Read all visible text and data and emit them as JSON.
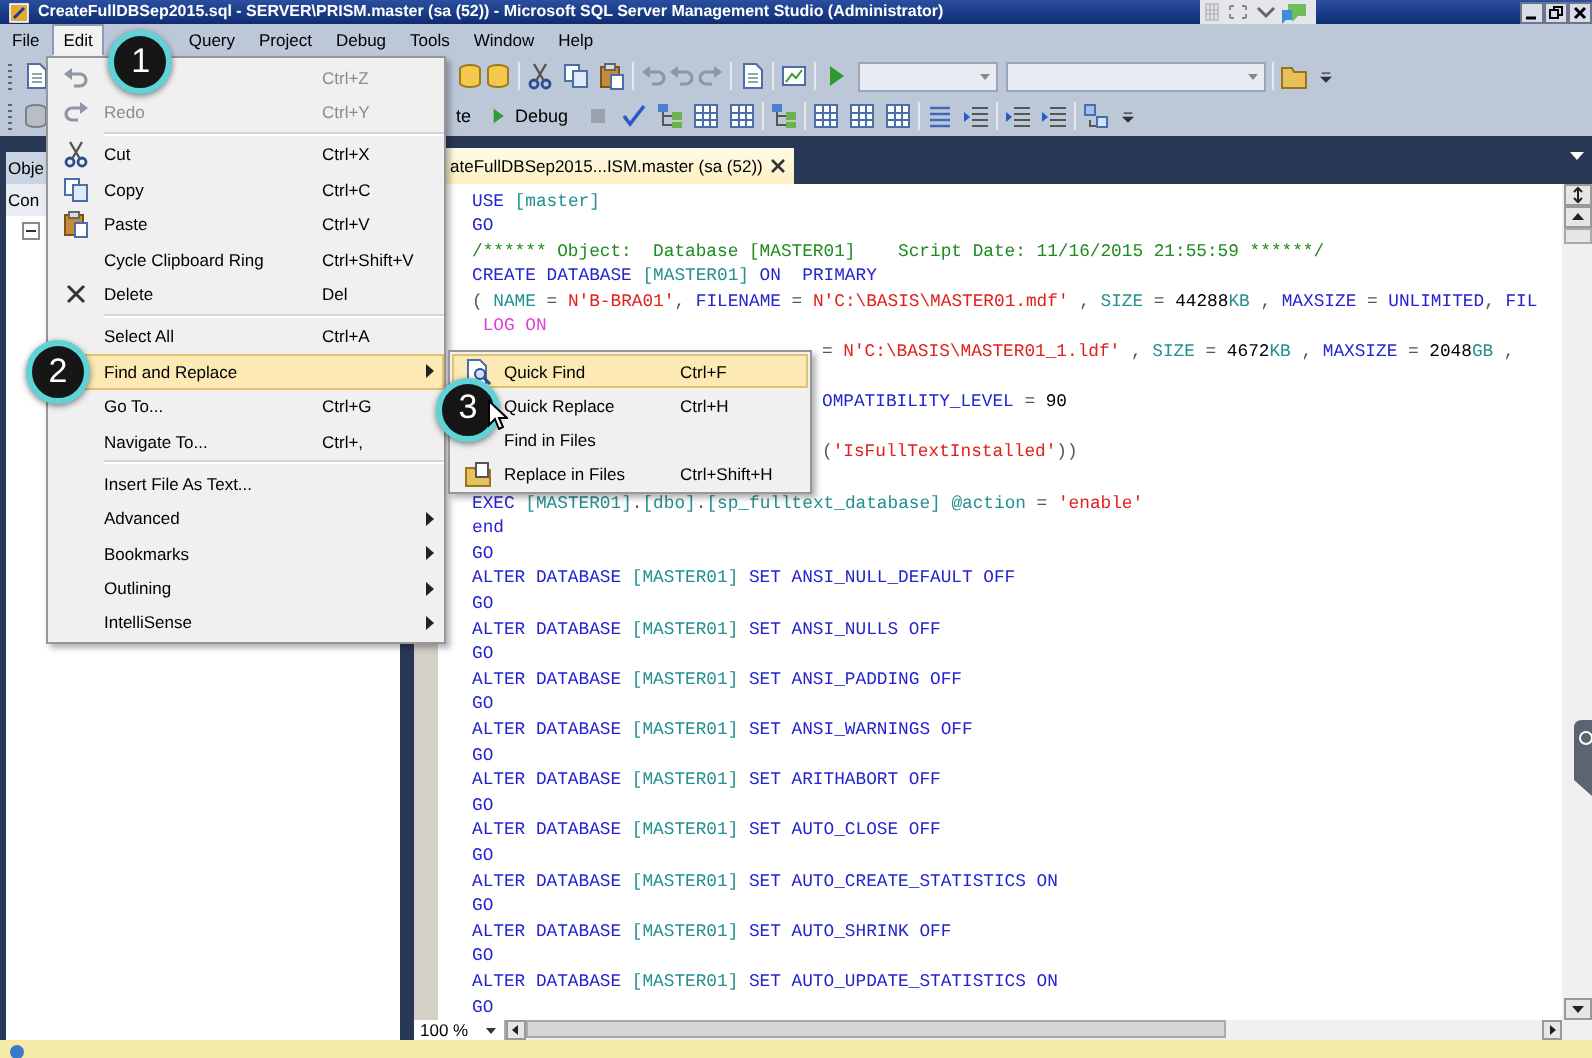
{
  "window": {
    "title": "CreateFullDBSep2015.sql - SERVER\\PRISM.master (sa (52)) - Microsoft SQL Server Management Studio (Administrator)"
  },
  "menu_bar": [
    {
      "label": "File",
      "selected": false
    },
    {
      "label": "Edit",
      "selected": true,
      "callout": "1"
    },
    {
      "label": "Query",
      "selected": false
    },
    {
      "label": "Project",
      "selected": false
    },
    {
      "label": "Debug",
      "selected": false
    },
    {
      "label": "Tools",
      "selected": false
    },
    {
      "label": "Window",
      "selected": false
    },
    {
      "label": "Help",
      "selected": false
    }
  ],
  "toolbar": {
    "execute_label": "te",
    "debug_label": "Debug"
  },
  "object_explorer": {
    "title": "Obje",
    "connect_label": "Con",
    "expanded": true
  },
  "document_tab": {
    "title": "ateFullDBSep2015...ISM.master (sa (52))"
  },
  "editor": {
    "zoom": "100 %",
    "lines": [
      {
        "covered": false,
        "tokens": [
          {
            "kind": "keyword",
            "text": "USE"
          },
          {
            "kind": "identifier",
            "text": " [master]"
          }
        ]
      },
      {
        "covered": false,
        "tokens": [
          {
            "kind": "keyword",
            "text": "GO"
          }
        ]
      },
      {
        "covered": false,
        "tokens": [
          {
            "kind": "comment",
            "text": "/****** Object:  Database [MASTER01]    Script Date: 11/16/2015 21:55:59 ******/"
          }
        ]
      },
      {
        "covered": false,
        "tokens": [
          {
            "kind": "keyword",
            "text": "CREATE DATABASE"
          },
          {
            "kind": "identifier",
            "text": " [MASTER01]"
          },
          {
            "kind": "keyword",
            "text": " ON  PRIMARY"
          }
        ]
      },
      {
        "covered": false,
        "tokens": [
          {
            "kind": "plain",
            "text": "( "
          },
          {
            "kind": "identifier",
            "text": "NAME"
          },
          {
            "kind": "plain",
            "text": " = "
          },
          {
            "kind": "string",
            "text": "N'B-BRA01'"
          },
          {
            "kind": "plain",
            "text": ", "
          },
          {
            "kind": "keyword",
            "text": "FILENAME"
          },
          {
            "kind": "plain",
            "text": " = "
          },
          {
            "kind": "string",
            "text": "N'C:\\BASIS\\MASTER01.mdf'"
          },
          {
            "kind": "plain",
            "text": " , "
          },
          {
            "kind": "identifier",
            "text": "SIZE"
          },
          {
            "kind": "plain",
            "text": " = "
          },
          {
            "kind": "number",
            "text": "44288"
          },
          {
            "kind": "identifier",
            "text": "KB"
          },
          {
            "kind": "plain",
            "text": " , "
          },
          {
            "kind": "keyword",
            "text": "MAXSIZE"
          },
          {
            "kind": "plain",
            "text": " = "
          },
          {
            "kind": "keyword",
            "text": "UNLIMITED"
          },
          {
            "kind": "plain",
            "text": ", "
          },
          {
            "kind": "keyword",
            "text": "FIL"
          }
        ]
      },
      {
        "covered": false,
        "tokens": [
          {
            "kind": "system",
            "text": " LOG ON"
          }
        ]
      },
      {
        "covered": true,
        "tokens": [
          {
            "kind": "plain",
            "text": "= "
          },
          {
            "kind": "string",
            "text": "N'C:\\BASIS\\MASTER01_1.ldf'"
          },
          {
            "kind": "plain",
            "text": " , "
          },
          {
            "kind": "identifier",
            "text": "SIZE"
          },
          {
            "kind": "plain",
            "text": " = "
          },
          {
            "kind": "number",
            "text": "4672"
          },
          {
            "kind": "identifier",
            "text": "KB"
          },
          {
            "kind": "plain",
            "text": " , "
          },
          {
            "kind": "keyword",
            "text": "MAXSIZE"
          },
          {
            "kind": "plain",
            "text": " = "
          },
          {
            "kind": "number",
            "text": "2048"
          },
          {
            "kind": "identifier",
            "text": "GB"
          },
          {
            "kind": "plain",
            "text": " ,"
          }
        ]
      },
      {
        "covered": true,
        "tokens": [
          {
            "kind": "keyword",
            "text": "OMPATIBILITY_LEVEL"
          },
          {
            "kind": "plain",
            "text": " = "
          },
          {
            "kind": "number",
            "text": "90"
          }
        ]
      },
      {
        "covered": true,
        "tokens": [
          {
            "kind": "plain",
            "text": "("
          },
          {
            "kind": "string",
            "text": "'IsFullTextInstalled'"
          },
          {
            "kind": "plain",
            "text": "))"
          }
        ]
      },
      {
        "covered": false,
        "tokens": [
          {
            "kind": "keyword",
            "text": "EXEC"
          },
          {
            "kind": "identifier",
            "text": " [MASTER01]"
          },
          {
            "kind": "plain",
            "text": "."
          },
          {
            "kind": "identifier",
            "text": "[dbo]"
          },
          {
            "kind": "plain",
            "text": "."
          },
          {
            "kind": "identifier",
            "text": "[sp_fulltext_database] @action"
          },
          {
            "kind": "plain",
            "text": " = "
          },
          {
            "kind": "string",
            "text": "'enable'"
          }
        ]
      },
      {
        "covered": false,
        "tokens": [
          {
            "kind": "keyword",
            "text": "end"
          }
        ]
      },
      {
        "covered": false,
        "tokens": [
          {
            "kind": "keyword",
            "text": "GO"
          }
        ]
      },
      {
        "covered": false,
        "tokens": [
          {
            "kind": "keyword",
            "text": "ALTER DATABASE"
          },
          {
            "kind": "identifier",
            "text": " [MASTER01]"
          },
          {
            "kind": "keyword",
            "text": " SET ANSI_NULL_DEFAULT OFF"
          }
        ]
      },
      {
        "covered": false,
        "tokens": [
          {
            "kind": "keyword",
            "text": "GO"
          }
        ]
      },
      {
        "covered": false,
        "tokens": [
          {
            "kind": "keyword",
            "text": "ALTER DATABASE"
          },
          {
            "kind": "identifier",
            "text": " [MASTER01]"
          },
          {
            "kind": "keyword",
            "text": " SET ANSI_NULLS OFF"
          }
        ]
      },
      {
        "covered": false,
        "tokens": [
          {
            "kind": "keyword",
            "text": "GO"
          }
        ]
      },
      {
        "covered": false,
        "tokens": [
          {
            "kind": "keyword",
            "text": "ALTER DATABASE"
          },
          {
            "kind": "identifier",
            "text": " [MASTER01]"
          },
          {
            "kind": "keyword",
            "text": " SET ANSI_PADDING OFF"
          }
        ]
      },
      {
        "covered": false,
        "tokens": [
          {
            "kind": "keyword",
            "text": "GO"
          }
        ]
      },
      {
        "covered": false,
        "tokens": [
          {
            "kind": "keyword",
            "text": "ALTER DATABASE"
          },
          {
            "kind": "identifier",
            "text": " [MASTER01]"
          },
          {
            "kind": "keyword",
            "text": " SET ANSI_WARNINGS OFF"
          }
        ]
      },
      {
        "covered": false,
        "tokens": [
          {
            "kind": "keyword",
            "text": "GO"
          }
        ]
      },
      {
        "covered": false,
        "tokens": [
          {
            "kind": "keyword",
            "text": "ALTER DATABASE"
          },
          {
            "kind": "identifier",
            "text": " [MASTER01]"
          },
          {
            "kind": "keyword",
            "text": " SET ARITHABORT OFF"
          }
        ]
      },
      {
        "covered": false,
        "tokens": [
          {
            "kind": "keyword",
            "text": "GO"
          }
        ]
      },
      {
        "covered": false,
        "tokens": [
          {
            "kind": "keyword",
            "text": "ALTER DATABASE"
          },
          {
            "kind": "identifier",
            "text": " [MASTER01]"
          },
          {
            "kind": "keyword",
            "text": " SET AUTO_CLOSE OFF"
          }
        ]
      },
      {
        "covered": false,
        "tokens": [
          {
            "kind": "keyword",
            "text": "GO"
          }
        ]
      },
      {
        "covered": false,
        "tokens": [
          {
            "kind": "keyword",
            "text": "ALTER DATABASE"
          },
          {
            "kind": "identifier",
            "text": " [MASTER01]"
          },
          {
            "kind": "keyword",
            "text": " SET AUTO_CREATE_STATISTICS ON"
          }
        ]
      },
      {
        "covered": false,
        "tokens": [
          {
            "kind": "keyword",
            "text": "GO"
          }
        ]
      },
      {
        "covered": false,
        "tokens": [
          {
            "kind": "keyword",
            "text": "ALTER DATABASE"
          },
          {
            "kind": "identifier",
            "text": " [MASTER01]"
          },
          {
            "kind": "keyword",
            "text": " SET AUTO_SHRINK OFF"
          }
        ]
      },
      {
        "covered": false,
        "tokens": [
          {
            "kind": "keyword",
            "text": "GO"
          }
        ]
      },
      {
        "covered": false,
        "tokens": [
          {
            "kind": "keyword",
            "text": "ALTER DATABASE"
          },
          {
            "kind": "identifier",
            "text": " [MASTER01]"
          },
          {
            "kind": "keyword",
            "text": " SET AUTO_UPDATE_STATISTICS ON"
          }
        ]
      },
      {
        "covered": false,
        "tokens": [
          {
            "kind": "keyword",
            "text": "GO"
          }
        ]
      }
    ]
  },
  "edit_menu": {
    "items": [
      {
        "kind": "item",
        "shortcut": "Ctrl+Z",
        "disabled": true,
        "selected": false,
        "submenu": false
      },
      {
        "kind": "item",
        "label": "Redo",
        "shortcut": "Ctrl+Y",
        "disabled": true,
        "selected": false,
        "submenu": false
      },
      {
        "kind": "separator"
      },
      {
        "kind": "item",
        "label": "Cut",
        "shortcut": "Ctrl+X",
        "disabled": false,
        "selected": false,
        "submenu": false
      },
      {
        "kind": "item",
        "label": "Copy",
        "shortcut": "Ctrl+C",
        "disabled": false,
        "selected": false,
        "submenu": false
      },
      {
        "kind": "item",
        "label": "Paste",
        "shortcut": "Ctrl+V",
        "disabled": false,
        "selected": false,
        "submenu": false
      },
      {
        "kind": "item",
        "label": "Cycle Clipboard Ring",
        "shortcut": "Ctrl+Shift+V",
        "disabled": false,
        "selected": false,
        "submenu": false
      },
      {
        "kind": "item",
        "label": "Delete",
        "shortcut": "Del",
        "disabled": false,
        "selected": false,
        "submenu": false
      },
      {
        "kind": "separator"
      },
      {
        "kind": "item",
        "label": "Select All",
        "shortcut": "Ctrl+A",
        "disabled": false,
        "selected": false,
        "submenu": false
      },
      {
        "kind": "item",
        "label": "Find and Replace",
        "disabled": false,
        "selected": true,
        "submenu": true,
        "callout": "2"
      },
      {
        "kind": "item",
        "label": "Go To...",
        "shortcut": "Ctrl+G",
        "disabled": false,
        "selected": false,
        "submenu": false
      },
      {
        "kind": "item",
        "label": "Navigate To...",
        "shortcut": "Ctrl+,",
        "disabled": false,
        "selected": false,
        "submenu": false
      },
      {
        "kind": "separator"
      },
      {
        "kind": "item",
        "label": "Insert File As Text...",
        "disabled": false,
        "selected": false,
        "submenu": false
      },
      {
        "kind": "item",
        "label": "Advanced",
        "disabled": false,
        "selected": false,
        "submenu": true
      },
      {
        "kind": "item",
        "label": "Bookmarks",
        "disabled": false,
        "selected": false,
        "submenu": true
      },
      {
        "kind": "item",
        "label": "Outlining",
        "disabled": false,
        "selected": false,
        "submenu": true
      },
      {
        "kind": "item",
        "label": "IntelliSense",
        "disabled": false,
        "selected": false,
        "submenu": true
      }
    ]
  },
  "find_replace_submenu": {
    "items": [
      {
        "label": "Quick Find",
        "shortcut": "Ctrl+F",
        "selected": true
      },
      {
        "label": "Quick Replace",
        "shortcut": "Ctrl+H",
        "selected": false,
        "callout": "3"
      },
      {
        "label": "Find in Files",
        "selected": false
      },
      {
        "label": "Replace in Files",
        "shortcut": "Ctrl+Shift+H",
        "selected": false
      }
    ]
  }
}
